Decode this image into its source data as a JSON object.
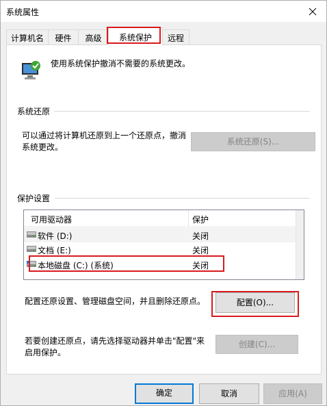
{
  "window": {
    "title": "系统属性"
  },
  "tabs": [
    {
      "label": "计算机名",
      "active": false
    },
    {
      "label": "硬件",
      "active": false
    },
    {
      "label": "高级",
      "active": false
    },
    {
      "label": "系统保护",
      "active": true
    },
    {
      "label": "远程",
      "active": false
    }
  ],
  "intro": {
    "text": "使用系统保护撤消不需要的系统更改。",
    "icon": "system-protection-icon"
  },
  "restore": {
    "group_label": "系统还原",
    "desc_line1": "可以通过将计算机还原到上一个还原点，撤消",
    "desc_line2": "系统更改。",
    "button_label": "系统还原(S)..."
  },
  "protection": {
    "group_label": "保护设置",
    "columns": [
      "可用驱动器",
      "保护"
    ],
    "drives": [
      {
        "name": "软件 (D:)",
        "status": "关闭",
        "icon": "drive-icon"
      },
      {
        "name": "文档 (E:)",
        "status": "关闭",
        "icon": "drive-icon"
      },
      {
        "name": "本地磁盘 (C:) (系统)",
        "status": "关闭",
        "icon": "system-drive-icon"
      }
    ],
    "configure_desc": "配置还原设置、管理磁盘空间，并且删除还原点。",
    "configure_button": "配置(O)...",
    "create_desc_line1": "若要创建还原点，请先选择驱动器并单击\"配置\"来",
    "create_desc_line2": "启用保护。",
    "create_button": "创建(C)..."
  },
  "footer": {
    "ok": "确定",
    "cancel": "取消",
    "apply": "应用(A)"
  },
  "colors": {
    "highlight": "#d9191e",
    "accent": "#0078d7"
  }
}
